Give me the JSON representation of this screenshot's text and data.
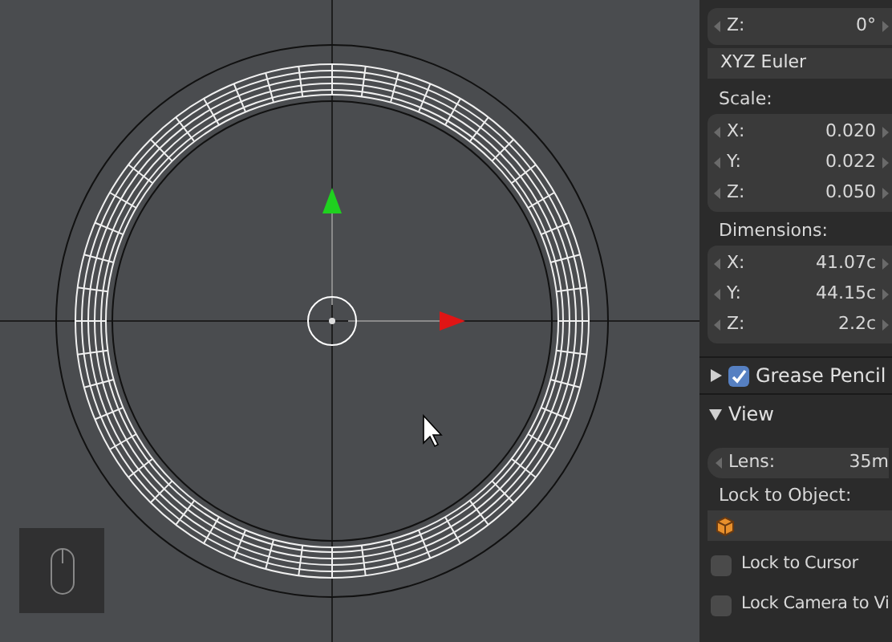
{
  "rotation": {
    "fields": [
      {
        "axis": "Z:",
        "value": "0°"
      }
    ],
    "mode": "XYZ Euler"
  },
  "scale": {
    "label": "Scale:",
    "fields": [
      {
        "axis": "X:",
        "value": "0.020"
      },
      {
        "axis": "Y:",
        "value": "0.022"
      },
      {
        "axis": "Z:",
        "value": "0.050"
      }
    ]
  },
  "dimensions": {
    "label": "Dimensions:",
    "fields": [
      {
        "axis": "X:",
        "value": "41.07c"
      },
      {
        "axis": "Y:",
        "value": "44.15c"
      },
      {
        "axis": "Z:",
        "value": "2.2c"
      }
    ]
  },
  "panels": [
    {
      "title": "Grease Pencil",
      "expanded": false,
      "checked": true
    },
    {
      "title": "View",
      "expanded": true
    }
  ],
  "view": {
    "lens": {
      "label": "Lens:",
      "value": "35m"
    },
    "lock_label": "Lock to Object:",
    "options": [
      {
        "label": "Lock to Cursor",
        "checked": false
      },
      {
        "label": "Lock Camera to Vi",
        "checked": false
      }
    ]
  }
}
